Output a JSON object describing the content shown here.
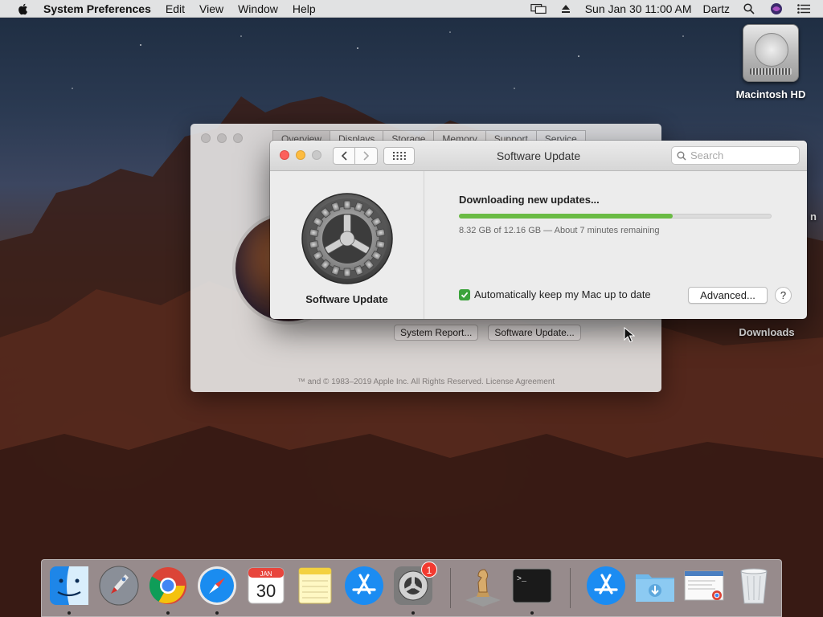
{
  "menubar": {
    "app_name": "System Preferences",
    "menus": [
      "Edit",
      "View",
      "Window",
      "Help"
    ],
    "date_time": "Sun Jan 30  11:00 AM",
    "user_name": "Dartz"
  },
  "desktop": {
    "hd_label": "Macintosh HD",
    "downloads_label": "Downloads",
    "partial_label": "n"
  },
  "about_window": {
    "tabs": [
      "Overview",
      "Displays",
      "Storage",
      "Memory",
      "Support",
      "Service"
    ],
    "system_report_label": "System Report...",
    "software_update_label": "Software Update...",
    "footer": "™ and © 1983–2019 Apple Inc. All Rights Reserved. License Agreement"
  },
  "software_update": {
    "window_title": "Software Update",
    "search_placeholder": "Search",
    "pane_label": "Software Update",
    "download_title": "Downloading new updates...",
    "progress_fraction": 0.6842,
    "status_text": "8.32 GB of 12.16 GB — About 7 minutes remaining",
    "auto_update_label": "Automatically keep my Mac up to date",
    "auto_update_checked": true,
    "advanced_label": "Advanced...",
    "help_label": "?"
  },
  "dock": {
    "items": [
      {
        "name": "Finder",
        "icon": "finder-icon"
      },
      {
        "name": "Launchpad",
        "icon": "launchpad-icon"
      },
      {
        "name": "Chrome",
        "icon": "chrome-icon"
      },
      {
        "name": "Safari",
        "icon": "safari-icon"
      },
      {
        "name": "Calendar",
        "icon": "calendar-icon",
        "month": "JAN",
        "day": "30"
      },
      {
        "name": "Notes",
        "icon": "notes-icon"
      },
      {
        "name": "App Store",
        "icon": "app-store-icon"
      },
      {
        "name": "System Preferences",
        "icon": "system-preferences-icon",
        "badge": "1"
      },
      {
        "name": "Chess",
        "icon": "chess-icon"
      },
      {
        "name": "Terminal",
        "icon": "terminal-icon",
        "prompt": ">_"
      },
      {
        "name": "App Store",
        "icon": "app-store-icon"
      },
      {
        "name": "Downloads",
        "icon": "downloads-folder-icon"
      },
      {
        "name": "Document",
        "icon": "document-icon"
      },
      {
        "name": "Trash",
        "icon": "trash-icon"
      }
    ]
  },
  "colors": {
    "progress_fill": "#6abb44",
    "checkbox": "#3ba33b",
    "close": "#fc605c",
    "minimize": "#fdbc40",
    "badge": "#f23a30"
  }
}
